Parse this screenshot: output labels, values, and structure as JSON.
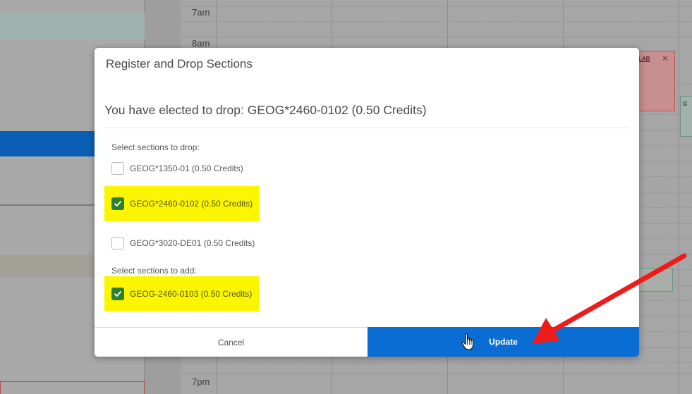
{
  "calendar": {
    "time_labels": [
      "7am",
      "8am",
      "7pm"
    ],
    "event_lab_label": "LAB",
    "event_partial_label": "G"
  },
  "modal": {
    "title": "Register and Drop Sections",
    "subtitle": "You have elected to drop: GEOG*2460-0102 (0.50 Credits)",
    "drop_section_label": "Select sections to drop:",
    "drop_sections": [
      {
        "label": "GEOG*1350-01 (0.50 Credits)",
        "checked": false,
        "highlighted": false
      },
      {
        "label": "GEOG*2460-0102 (0.50 Credits)",
        "checked": true,
        "highlighted": true
      },
      {
        "label": "GEOG*3020-DE01 (0.50 Credits)",
        "checked": false,
        "highlighted": false
      }
    ],
    "add_section_label": "Select sections to add:",
    "add_sections": [
      {
        "label": "GEOG-2460-0103 (0.50 Credits)",
        "checked": true,
        "highlighted": true
      }
    ],
    "cancel_label": "Cancel",
    "update_label": "Update"
  },
  "colors": {
    "highlight": "#fcf500",
    "checkbox_checked": "#2e7f2e",
    "update_button": "#0a6dd3",
    "annotation_arrow": "#ee1b1b"
  },
  "icons": {
    "check": "check-icon",
    "cursor": "hand-pointer-icon",
    "close": "close-icon",
    "annotation": "red-arrow-icon"
  }
}
